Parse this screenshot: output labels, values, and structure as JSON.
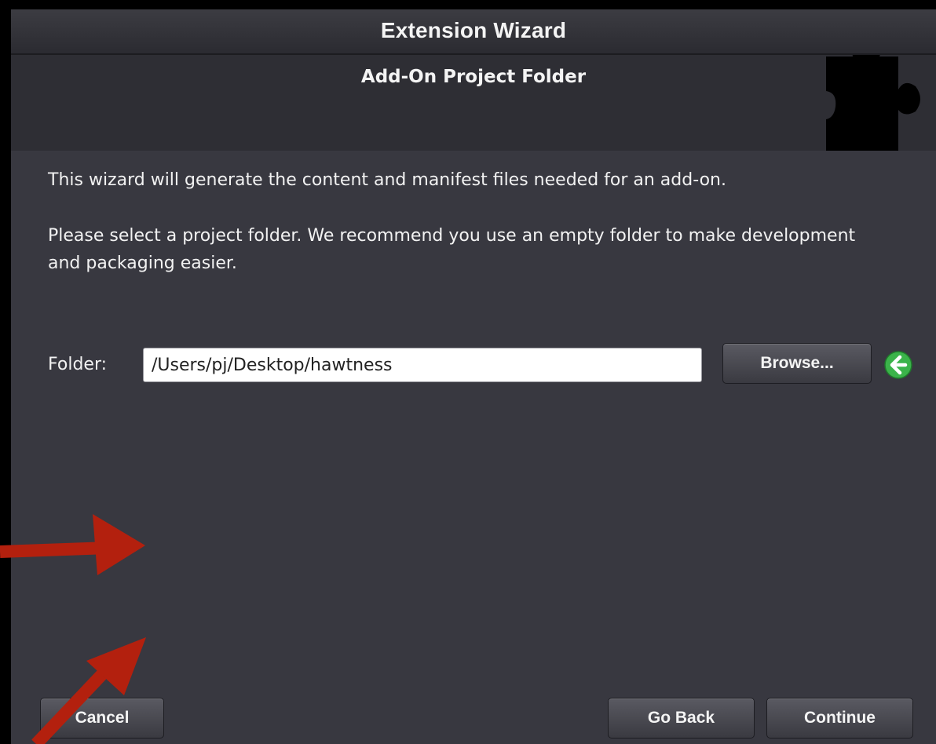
{
  "window": {
    "title": "Extension Wizard"
  },
  "header": {
    "subtitle": "Add-On Project Folder",
    "icon": "puzzle-piece-icon"
  },
  "content": {
    "intro": "This wizard will generate the content and manifest files needed for an add-on.",
    "instruction": "Please select a project folder. We recommend you use an empty folder to make development and packaging easier."
  },
  "folder": {
    "label": "Folder:",
    "value": "/Users/pj/Desktop/hawtness",
    "browse_label": "Browse...",
    "go_icon": "green-arrow-left-icon"
  },
  "buttons": {
    "cancel": "Cancel",
    "go_back": "Go Back",
    "continue": "Continue"
  },
  "colors": {
    "background": "#383840",
    "header": "#2e2e34",
    "annotation_arrow": "#b3200e",
    "go_icon": "#3bb34a"
  }
}
